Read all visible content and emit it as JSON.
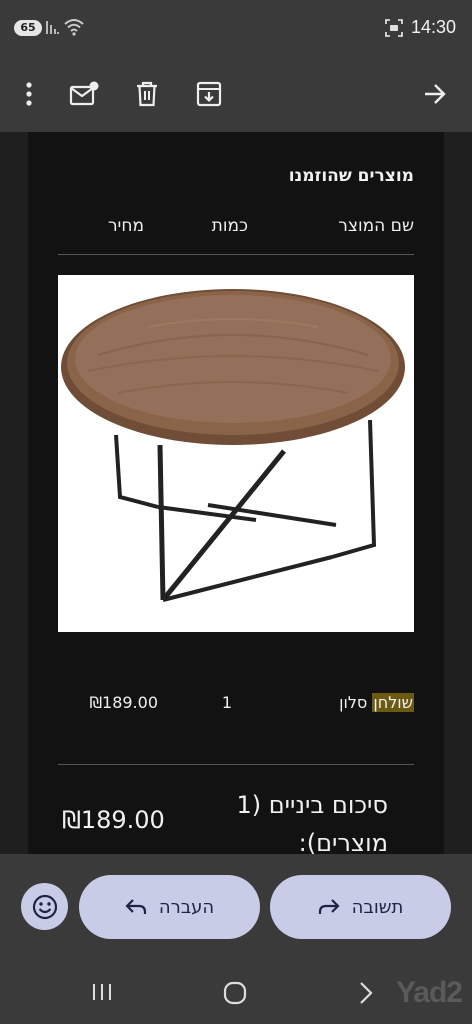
{
  "status_bar": {
    "battery": "65",
    "time": "14:30"
  },
  "email": {
    "section_title": "מוצרים שהוזמנו",
    "table_headers": {
      "product_name": "שם המוצר",
      "quantity": "כמות",
      "price": "מחיר"
    },
    "product_row": {
      "name_highlight": "שולחן",
      "name_rest": " סלון",
      "quantity": "1",
      "price": "₪189.00"
    },
    "subtotal_label": "סיכום ביניים (1 מוצרים):",
    "subtotal_value": "₪189.00"
  },
  "actions": {
    "reply_label": "תשובה",
    "forward_label": "העברה"
  },
  "watermark": "Yad2",
  "colors": {
    "button_bg": "#c9cce6",
    "highlight": "#6b5a12",
    "bar_bg": "#3a3a3a"
  }
}
